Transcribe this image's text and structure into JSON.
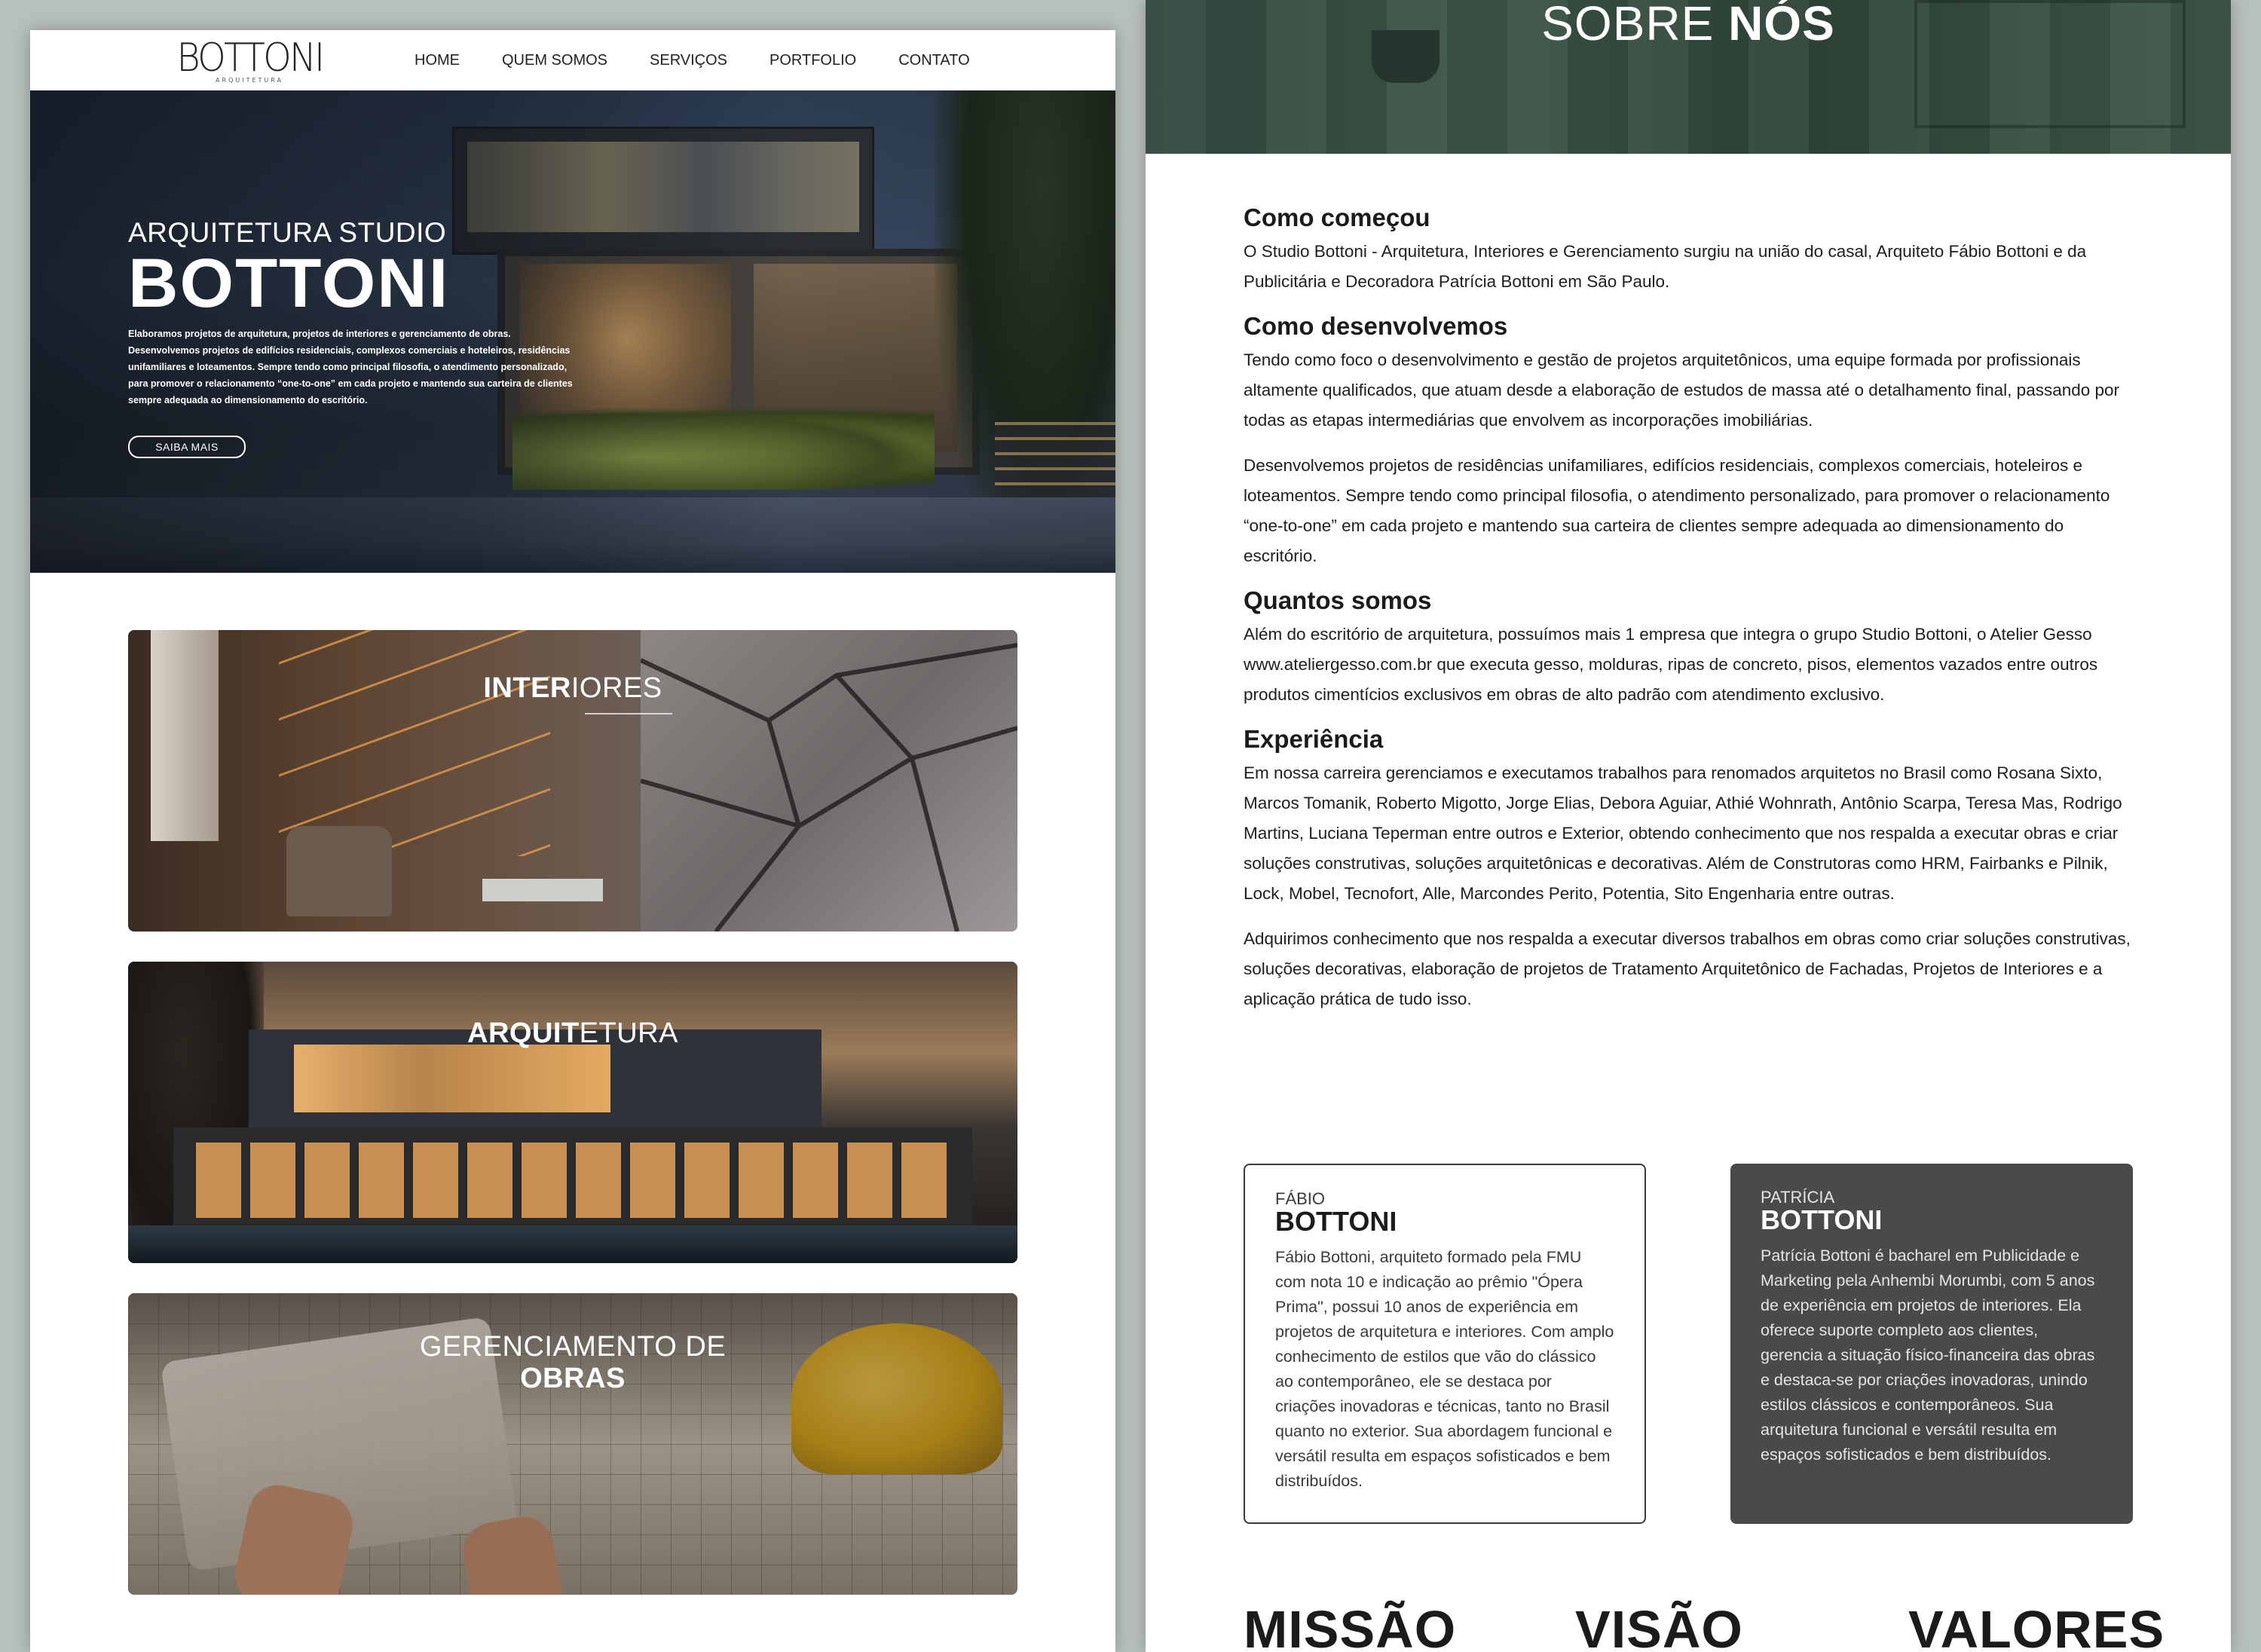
{
  "header": {
    "logo": "BOTTONI",
    "logo_sub": "ARQUITETURA",
    "nav": [
      "HOME",
      "QUEM SOMOS",
      "SERVIÇOS",
      "PORTFOLIO",
      "CONTATO"
    ]
  },
  "hero": {
    "kicker": "ARQUITETURA STUDIO",
    "title": "BOTTONI",
    "description": "Elaboramos projetos de arquitetura, projetos de interiores e gerenciamento de obras. Desenvolvemos projetos de edifícios residenciais, complexos comerciais e hoteleiros, residências unifamiliares e loteamentos. Sempre tendo como principal filosofia, o atendimento personalizado, para promover o relacionamento “one-to-one” em cada projeto e mantendo sua carteira de clientes sempre adequada ao dimensionamento do escritório.",
    "button": "SAIBA MAIS"
  },
  "services": [
    {
      "bold": "INTER",
      "thin": "IORES"
    },
    {
      "bold": "ARQUIT",
      "thin": "ETURA"
    },
    {
      "line1": "GERENCIAMENTO DE",
      "line2": "OBRAS"
    }
  ],
  "about": {
    "banner_light": "SOBRE ",
    "banner_bold": "NÓS",
    "sections": [
      {
        "title": "Como começou",
        "paragraphs": [
          "O Studio Bottoni - Arquitetura, Interiores e Gerenciamento surgiu na união do casal, Arquiteto Fábio Bottoni e da Publicitária e Decoradora Patrícia Bottoni em São Paulo."
        ]
      },
      {
        "title": "Como desenvolvemos",
        "paragraphs": [
          "Tendo como foco o desenvolvimento e gestão de projetos arquitetônicos, uma equipe formada por profissionais altamente qualificados, que atuam desde a elaboração de estudos de massa até o detalhamento final, passando por todas as etapas intermediárias que envolvem as incorporações imobiliárias.",
          "Desenvolvemos projetos de residências unifamiliares, edifícios residenciais, complexos comerciais, hoteleiros e loteamentos. Sempre tendo como principal filosofia, o atendimento personalizado, para promover o relacionamento “one-to-one” em cada projeto e mantendo sua carteira de clientes sempre adequada ao dimensionamento do escritório."
        ]
      },
      {
        "title": "Quantos somos",
        "paragraphs": [
          "Além do escritório de arquitetura, possuímos mais 1 empresa que integra o grupo Studio Bottoni, o Atelier Gesso www.ateliergesso.com.br que executa gesso, molduras, ripas de concreto, pisos, elementos vazados entre outros produtos cimentícios exclusivos em obras de alto padrão com atendimento exclusivo."
        ]
      },
      {
        "title": "Experiência",
        "paragraphs": [
          "Em nossa carreira gerenciamos e executamos trabalhos para renomados arquitetos no Brasil como Rosana Sixto, Marcos Tomanik, Roberto Migotto, Jorge Elias, Debora Aguiar, Athié Wohnrath, Antônio Scarpa, Teresa Mas, Rodrigo Martins, Luciana Teperman entre outros e Exterior, obtendo conhecimento que nos respalda a executar obras e criar soluções construtivas, soluções arquitetônicas e decorativas. Além de Construtoras como HRM, Fairbanks e Pilnik, Lock, Mobel, Tecnofort, Alle, Marcondes Perito, Potentia, Sito Engenharia entre outras.",
          "Adquirimos conhecimento que nos respalda a executar diversos trabalhos em obras como criar soluções construtivas, soluções decorativas, elaboração de projetos de Tratamento Arquitetônico de Fachadas, Projetos de Interiores e a aplicação prática de tudo isso."
        ]
      }
    ]
  },
  "people": [
    {
      "first": "FÁBIO",
      "last": "BOTTONI",
      "bio": "Fábio Bottoni, arquiteto formado pela FMU com nota 10 e indicação ao prêmio \"Ópera Prima\", possui 10 anos de experiência em projetos de arquitetura e interiores. Com amplo conhecimento de estilos que vão do clássico ao contemporâneo, ele se destaca por criações inovadoras e técnicas, tanto no Brasil quanto no exterior. Sua abordagem funcional e versátil resulta em espaços sofisticados e bem distribuídos."
    },
    {
      "first": "PATRÍCIA",
      "last": "BOTTONI",
      "bio": "Patrícia Bottoni é bacharel em Publicidade e Marketing pela Anhembi Morumbi, com 5 anos de experiência em projetos de interiores. Ela oferece suporte completo aos clientes, gerencia a situação físico-financeira das obras e destaca-se por criações inovadoras, unindo estilos clássicos e contemporâneos. Sua arquitetura funcional e versátil resulta em espaços sofisticados e bem distribuídos."
    }
  ],
  "mvv": [
    "MISSÃO",
    "VISÃO",
    "VALORES"
  ]
}
